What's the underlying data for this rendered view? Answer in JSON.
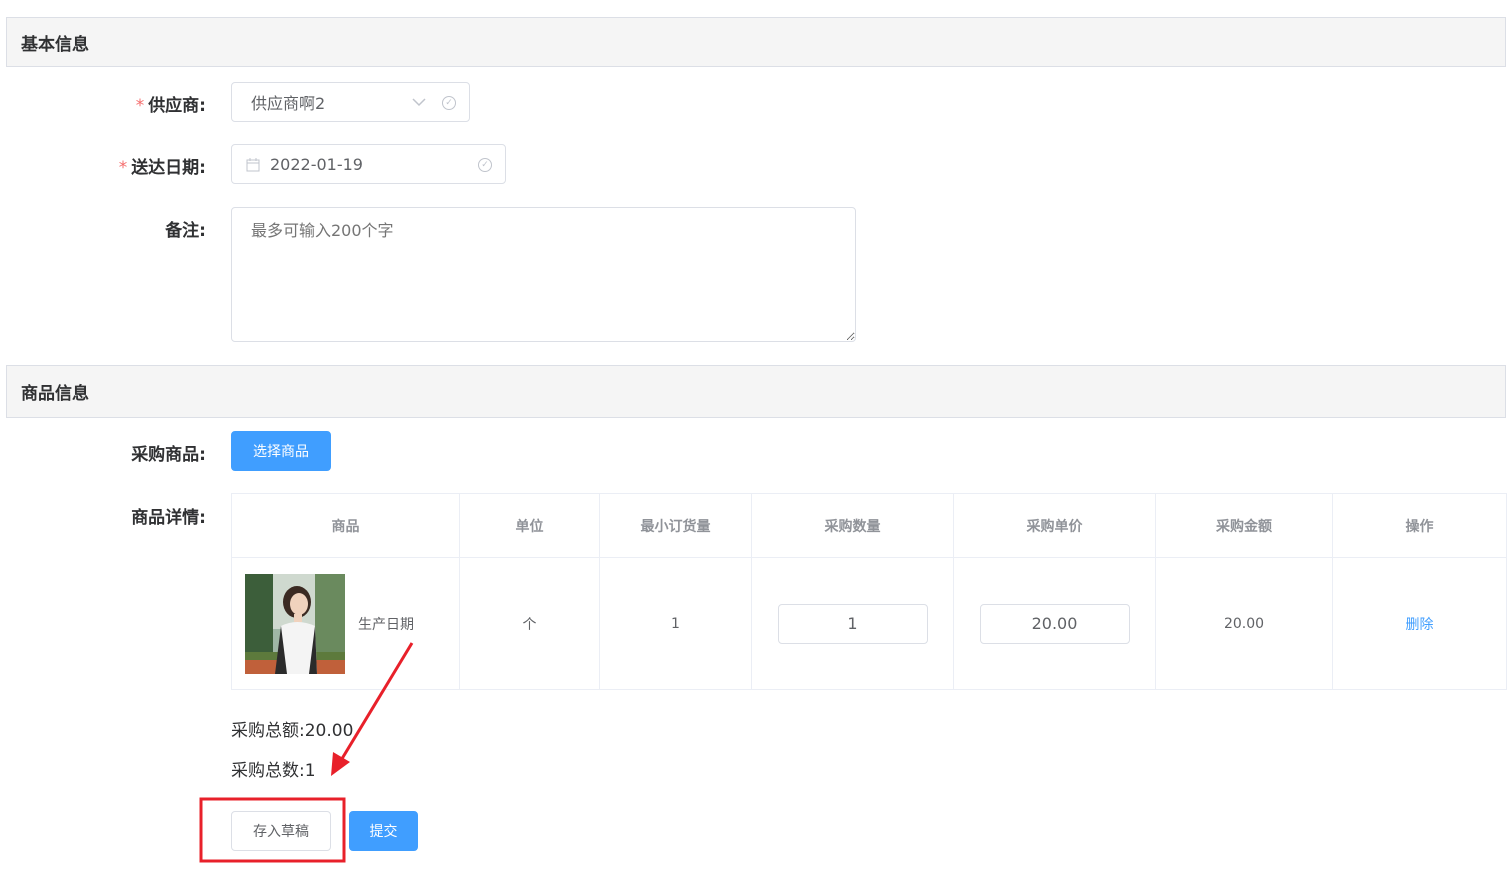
{
  "basic_section": {
    "title": "基本信息"
  },
  "supplier": {
    "label": "供应商:",
    "value": "供应商啊2"
  },
  "delivery_date": {
    "label": "送达日期:",
    "value": "2022-01-19"
  },
  "remark": {
    "label": "备注:",
    "placeholder": "最多可输入200个字"
  },
  "goods_section": {
    "title": "商品信息"
  },
  "purchase_goods": {
    "label": "采购商品:",
    "button": "选择商品"
  },
  "goods_detail": {
    "label": "商品详情:"
  },
  "table": {
    "headers": [
      "商品",
      "单位",
      "最小订货量",
      "采购数量",
      "采购单价",
      "采购金额",
      "操作"
    ],
    "rows": [
      {
        "product_name": "生产日期",
        "unit": "个",
        "min_order": "1",
        "qty": "1",
        "unit_price": "20.00",
        "amount": "20.00",
        "action": "删除"
      }
    ]
  },
  "summary": {
    "total_amount_label": "采购总额:",
    "total_amount": "20.00",
    "total_count_label": "采购总数:",
    "total_count": "1"
  },
  "actions": {
    "draft": "存入草稿",
    "submit": "提交"
  },
  "colors": {
    "primary": "#409eff",
    "required": "#f56c6c",
    "annotation": "#e8202a"
  },
  "required_mark": "*"
}
